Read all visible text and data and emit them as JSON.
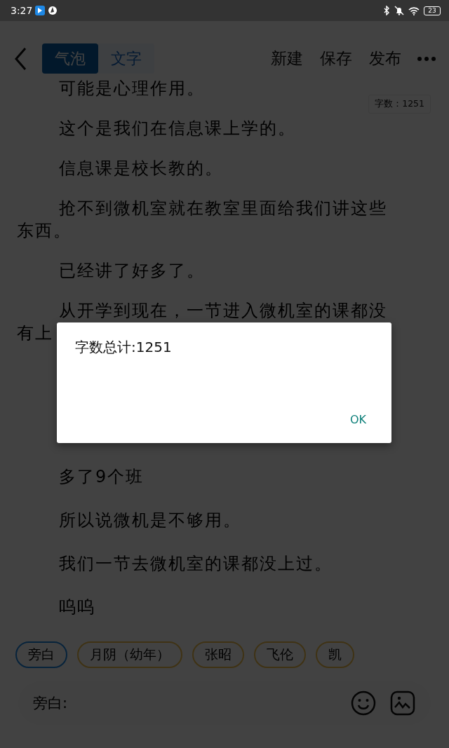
{
  "status_bar": {
    "time": "3:27",
    "battery": "23"
  },
  "header": {
    "tabs": [
      {
        "label": "气泡",
        "selected": true
      },
      {
        "label": "文字",
        "selected": false
      }
    ],
    "actions": [
      "新建",
      "保存",
      "发布"
    ]
  },
  "word_count_badge": "字数：1251",
  "article": {
    "paragraphs": [
      "可能是心理作用。",
      "这个是我们在信息课上学的。",
      "信息课是校长教的。",
      "抢不到微机室就在教室里面给我们讲这些东西。",
      "已经讲了好多了。",
      "从开学到现在，一节进入微机室的课都没有上"
    ],
    "paragraphs_after_dialog": [
      "多了9个班",
      "所以说微机是不够用。",
      "我们一节去微机室的课都没上过。",
      "呜呜"
    ]
  },
  "role_chips": [
    {
      "label": "旁白",
      "selected": true
    },
    {
      "label": "月阴（幼年）",
      "selected": false
    },
    {
      "label": "张昭",
      "selected": false
    },
    {
      "label": "飞伦",
      "selected": false
    },
    {
      "label": "凯",
      "selected": false
    }
  ],
  "input_bar": {
    "label": "旁白:"
  },
  "dialog": {
    "message": "字数总计:1251",
    "button": "OK"
  }
}
